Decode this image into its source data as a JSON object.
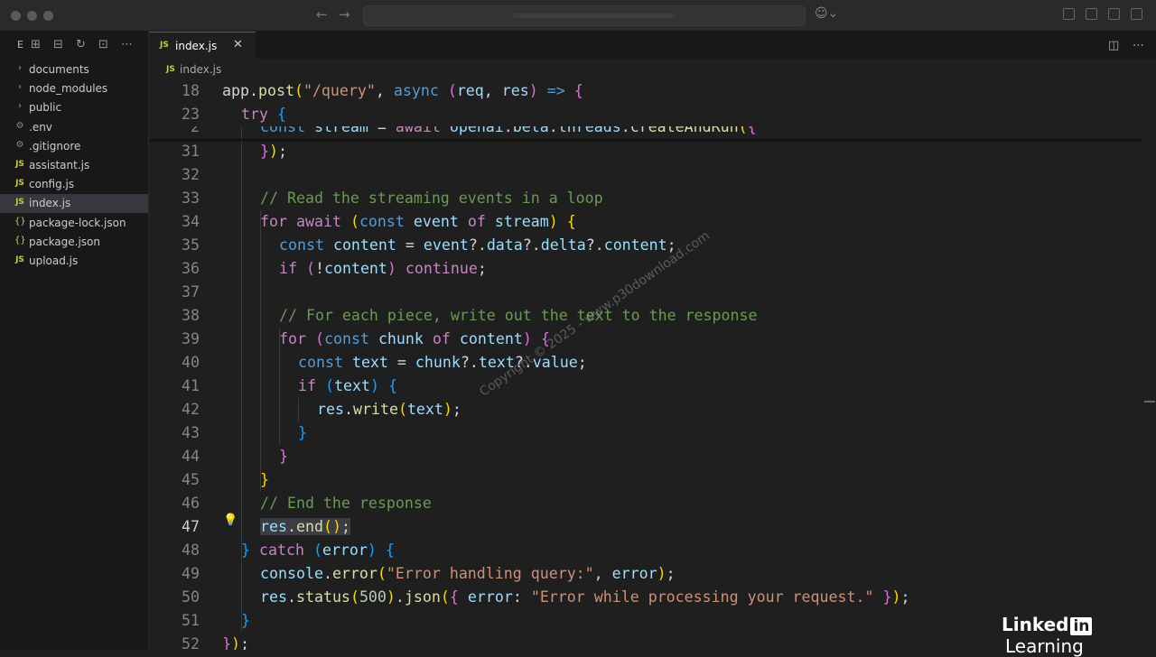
{
  "sidebar": {
    "header_label": "E",
    "items": [
      {
        "label": "documents",
        "kind": "folder"
      },
      {
        "label": "node_modules",
        "kind": "folder"
      },
      {
        "label": "public",
        "kind": "folder"
      },
      {
        "label": ".env",
        "kind": "gear"
      },
      {
        "label": ".gitignore",
        "kind": "gear"
      },
      {
        "label": "assistant.js",
        "kind": "js"
      },
      {
        "label": "config.js",
        "kind": "js"
      },
      {
        "label": "index.js",
        "kind": "js",
        "active": true
      },
      {
        "label": "package-lock.json",
        "kind": "json"
      },
      {
        "label": "package.json",
        "kind": "json"
      },
      {
        "label": "upload.js",
        "kind": "js"
      }
    ]
  },
  "editor": {
    "tab_label": "index.js",
    "tab_close": "✕",
    "breadcrumb": "index.js",
    "js_badge": "JS",
    "active_line": "47",
    "line_numbers": [
      "18",
      "23",
      "2",
      "31",
      "32",
      "33",
      "34",
      "35",
      "36",
      "37",
      "38",
      "39",
      "40",
      "41",
      "42",
      "43",
      "44",
      "45",
      "46",
      "47",
      "48",
      "49",
      "50",
      "51",
      "52"
    ]
  },
  "watermark": "Copyright © 2025 - www.p30download.com",
  "brand": {
    "name": "Linked",
    "in": "in",
    "product": "Learning"
  },
  "colors": {
    "accent": "#0078d4",
    "keyword": "#c586c0",
    "string": "#ce9178",
    "comment": "#6a9955"
  }
}
